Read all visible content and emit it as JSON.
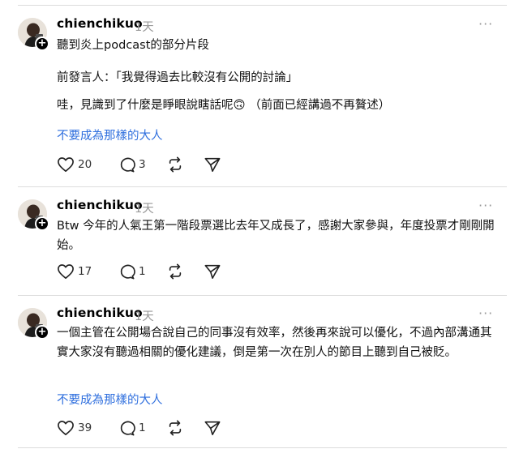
{
  "posts": [
    {
      "username": "chienchikuo",
      "time": "1天",
      "more": "···",
      "paragraphs": [
        "聽到炎上podcast的部分片段",
        "前發言人：「我覺得過去比較沒有公開的討論」",
        "哇，見識到了什麼是睜眼說瞎話呢🙃 （前面已經講過不再贅述）"
      ],
      "link_text": "不要成為那樣的大人",
      "likes": "20",
      "comments": "3"
    },
    {
      "username": "chienchikuo",
      "time": "1天",
      "more": "···",
      "paragraphs": [
        "Btw 今年的人氣王第一階段票選比去年又成長了，感謝大家參與，年度投票才剛剛開始。"
      ],
      "likes": "17",
      "comments": "1"
    },
    {
      "username": "chienchikuo",
      "time": "1天",
      "more": "···",
      "paragraphs": [
        "一個主管在公開場合說自己的同事沒有效率，然後再來說可以優化，不過內部溝通其實大家沒有聽過相關的優化建議，倒是第一次在別人的節目上聽到自己被貶。"
      ],
      "link_text": "不要成為那樣的大人",
      "likes": "39",
      "comments": "1"
    }
  ],
  "icons": {
    "like": "heart-icon",
    "comment": "comment-bubble-icon",
    "repost": "repost-icon",
    "share": "send-icon",
    "follow": "plus-icon"
  },
  "colors": {
    "link": "#2f6fde",
    "muted": "#9a9a9a",
    "divider": "#dcdcdc"
  }
}
